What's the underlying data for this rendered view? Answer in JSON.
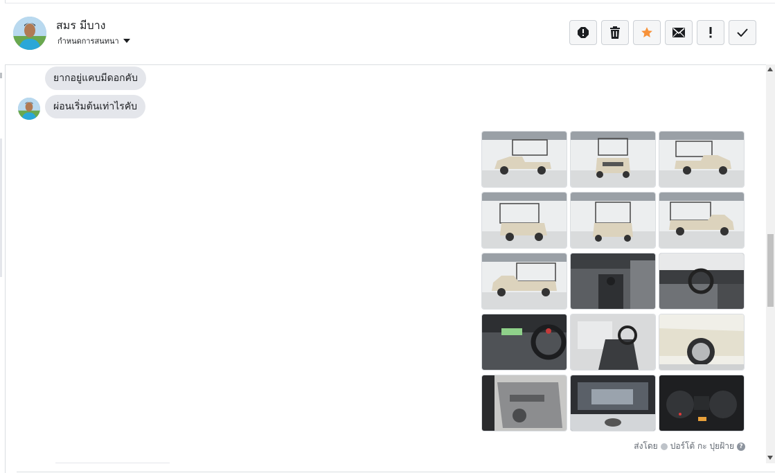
{
  "contact": {
    "name": "สมร มีบาง",
    "assign_label": "กำหนดการสนทนา"
  },
  "toolbar": {
    "buttons": [
      "spam-icon",
      "trash-icon",
      "star-icon",
      "mail-icon",
      "exclamation-icon",
      "check-icon"
    ],
    "star_color": "#f7923a"
  },
  "messages": [
    {
      "sender": "contact",
      "text": "ยากอยู่แคบมีดอกคับ"
    },
    {
      "sender": "contact",
      "text": "ผ่อนเริ่มต้นเท่าไรคับ"
    }
  ],
  "gallery": {
    "photos": [
      "front-left exterior",
      "front exterior",
      "front-right exterior",
      "rear-left exterior",
      "rear exterior",
      "right side exterior",
      "left side exterior",
      "gear shifter interior",
      "dashboard interior",
      "steering wheel interior",
      "front seat interior",
      "wheel close-up",
      "door panel",
      "engine bay",
      "instrument cluster"
    ]
  },
  "footer": {
    "sent_by_label": "ส่งโดย",
    "agent_name": "ปอร์โต้ กะ ปุยฝ้าย",
    "help": "?"
  }
}
